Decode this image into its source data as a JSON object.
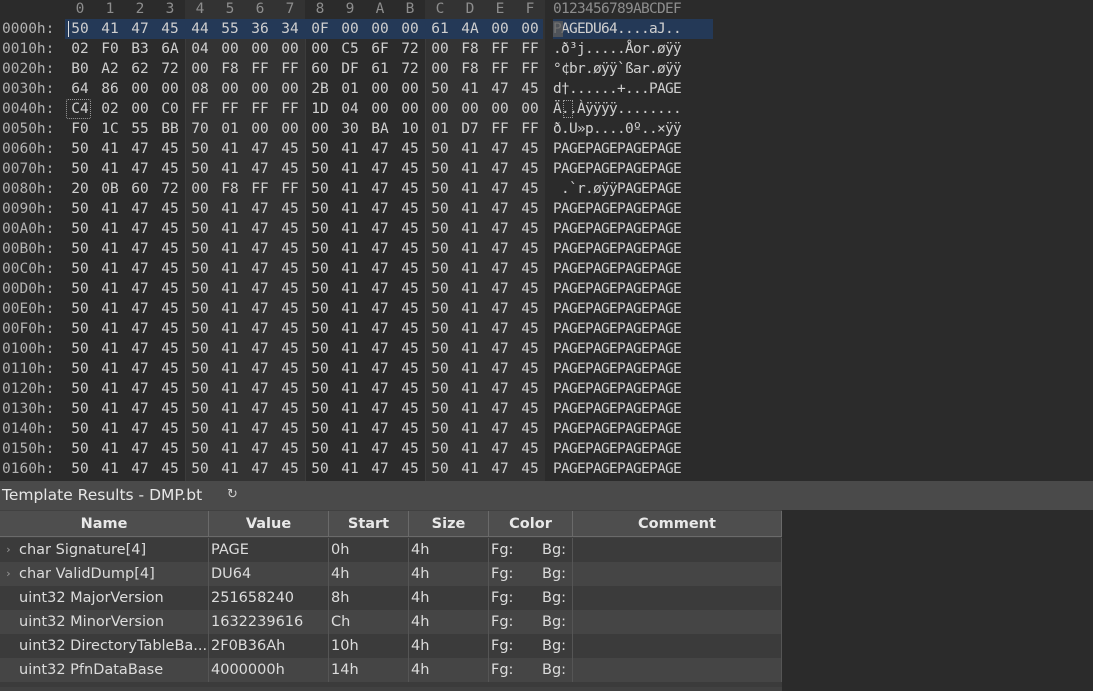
{
  "hex_view": {
    "columns": [
      "0",
      "1",
      "2",
      "3",
      "4",
      "5",
      "6",
      "7",
      "8",
      "9",
      "A",
      "B",
      "C",
      "D",
      "E",
      "F"
    ],
    "ascii_header": "0123456789ABCDEF",
    "rows": [
      {
        "addr": "0000h:",
        "bytes": [
          "50",
          "41",
          "47",
          "45",
          "44",
          "55",
          "36",
          "34",
          "0F",
          "00",
          "00",
          "00",
          "61",
          "4A",
          "00",
          "00"
        ],
        "ascii": "PAGEDU64....aJ.."
      },
      {
        "addr": "0010h:",
        "bytes": [
          "02",
          "F0",
          "B3",
          "6A",
          "04",
          "00",
          "00",
          "00",
          "00",
          "C5",
          "6F",
          "72",
          "00",
          "F8",
          "FF",
          "FF"
        ],
        "ascii": ".ð³j.....Åor.øÿÿ"
      },
      {
        "addr": "0020h:",
        "bytes": [
          "B0",
          "A2",
          "62",
          "72",
          "00",
          "F8",
          "FF",
          "FF",
          "60",
          "DF",
          "61",
          "72",
          "00",
          "F8",
          "FF",
          "FF"
        ],
        "ascii": "°¢br.øÿÿ`ßar.øÿÿ"
      },
      {
        "addr": "0030h:",
        "bytes": [
          "64",
          "86",
          "00",
          "00",
          "08",
          "00",
          "00",
          "00",
          "2B",
          "01",
          "00",
          "00",
          "50",
          "41",
          "47",
          "45"
        ],
        "ascii": "d†......+...PAGE"
      },
      {
        "addr": "0040h:",
        "bytes": [
          "C4",
          "02",
          "00",
          "C0",
          "FF",
          "FF",
          "FF",
          "FF",
          "1D",
          "04",
          "00",
          "00",
          "00",
          "00",
          "00",
          "00"
        ],
        "ascii": "Ä..Àÿÿÿÿ........"
      },
      {
        "addr": "0050h:",
        "bytes": [
          "F0",
          "1C",
          "55",
          "BB",
          "70",
          "01",
          "00",
          "00",
          "00",
          "30",
          "BA",
          "10",
          "01",
          "D7",
          "FF",
          "FF"
        ],
        "ascii": "ð.U»p....0º..×ÿÿ"
      },
      {
        "addr": "0060h:",
        "bytes": [
          "50",
          "41",
          "47",
          "45",
          "50",
          "41",
          "47",
          "45",
          "50",
          "41",
          "47",
          "45",
          "50",
          "41",
          "47",
          "45"
        ],
        "ascii": "PAGEPAGEPAGEPAGE"
      },
      {
        "addr": "0070h:",
        "bytes": [
          "50",
          "41",
          "47",
          "45",
          "50",
          "41",
          "47",
          "45",
          "50",
          "41",
          "47",
          "45",
          "50",
          "41",
          "47",
          "45"
        ],
        "ascii": "PAGEPAGEPAGEPAGE"
      },
      {
        "addr": "0080h:",
        "bytes": [
          "20",
          "0B",
          "60",
          "72",
          "00",
          "F8",
          "FF",
          "FF",
          "50",
          "41",
          "47",
          "45",
          "50",
          "41",
          "47",
          "45"
        ],
        "ascii": " .`r.øÿÿPAGEPAGE"
      },
      {
        "addr": "0090h:",
        "bytes": [
          "50",
          "41",
          "47",
          "45",
          "50",
          "41",
          "47",
          "45",
          "50",
          "41",
          "47",
          "45",
          "50",
          "41",
          "47",
          "45"
        ],
        "ascii": "PAGEPAGEPAGEPAGE"
      },
      {
        "addr": "00A0h:",
        "bytes": [
          "50",
          "41",
          "47",
          "45",
          "50",
          "41",
          "47",
          "45",
          "50",
          "41",
          "47",
          "45",
          "50",
          "41",
          "47",
          "45"
        ],
        "ascii": "PAGEPAGEPAGEPAGE"
      },
      {
        "addr": "00B0h:",
        "bytes": [
          "50",
          "41",
          "47",
          "45",
          "50",
          "41",
          "47",
          "45",
          "50",
          "41",
          "47",
          "45",
          "50",
          "41",
          "47",
          "45"
        ],
        "ascii": "PAGEPAGEPAGEPAGE"
      },
      {
        "addr": "00C0h:",
        "bytes": [
          "50",
          "41",
          "47",
          "45",
          "50",
          "41",
          "47",
          "45",
          "50",
          "41",
          "47",
          "45",
          "50",
          "41",
          "47",
          "45"
        ],
        "ascii": "PAGEPAGEPAGEPAGE"
      },
      {
        "addr": "00D0h:",
        "bytes": [
          "50",
          "41",
          "47",
          "45",
          "50",
          "41",
          "47",
          "45",
          "50",
          "41",
          "47",
          "45",
          "50",
          "41",
          "47",
          "45"
        ],
        "ascii": "PAGEPAGEPAGEPAGE"
      },
      {
        "addr": "00E0h:",
        "bytes": [
          "50",
          "41",
          "47",
          "45",
          "50",
          "41",
          "47",
          "45",
          "50",
          "41",
          "47",
          "45",
          "50",
          "41",
          "47",
          "45"
        ],
        "ascii": "PAGEPAGEPAGEPAGE"
      },
      {
        "addr": "00F0h:",
        "bytes": [
          "50",
          "41",
          "47",
          "45",
          "50",
          "41",
          "47",
          "45",
          "50",
          "41",
          "47",
          "45",
          "50",
          "41",
          "47",
          "45"
        ],
        "ascii": "PAGEPAGEPAGEPAGE"
      },
      {
        "addr": "0100h:",
        "bytes": [
          "50",
          "41",
          "47",
          "45",
          "50",
          "41",
          "47",
          "45",
          "50",
          "41",
          "47",
          "45",
          "50",
          "41",
          "47",
          "45"
        ],
        "ascii": "PAGEPAGEPAGEPAGE"
      },
      {
        "addr": "0110h:",
        "bytes": [
          "50",
          "41",
          "47",
          "45",
          "50",
          "41",
          "47",
          "45",
          "50",
          "41",
          "47",
          "45",
          "50",
          "41",
          "47",
          "45"
        ],
        "ascii": "PAGEPAGEPAGEPAGE"
      },
      {
        "addr": "0120h:",
        "bytes": [
          "50",
          "41",
          "47",
          "45",
          "50",
          "41",
          "47",
          "45",
          "50",
          "41",
          "47",
          "45",
          "50",
          "41",
          "47",
          "45"
        ],
        "ascii": "PAGEPAGEPAGEPAGE"
      },
      {
        "addr": "0130h:",
        "bytes": [
          "50",
          "41",
          "47",
          "45",
          "50",
          "41",
          "47",
          "45",
          "50",
          "41",
          "47",
          "45",
          "50",
          "41",
          "47",
          "45"
        ],
        "ascii": "PAGEPAGEPAGEPAGE"
      },
      {
        "addr": "0140h:",
        "bytes": [
          "50",
          "41",
          "47",
          "45",
          "50",
          "41",
          "47",
          "45",
          "50",
          "41",
          "47",
          "45",
          "50",
          "41",
          "47",
          "45"
        ],
        "ascii": "PAGEPAGEPAGEPAGE"
      },
      {
        "addr": "0150h:",
        "bytes": [
          "50",
          "41",
          "47",
          "45",
          "50",
          "41",
          "47",
          "45",
          "50",
          "41",
          "47",
          "45",
          "50",
          "41",
          "47",
          "45"
        ],
        "ascii": "PAGEPAGEPAGEPAGE"
      },
      {
        "addr": "0160h:",
        "bytes": [
          "50",
          "41",
          "47",
          "45",
          "50",
          "41",
          "47",
          "45",
          "50",
          "41",
          "47",
          "45",
          "50",
          "41",
          "47",
          "45"
        ],
        "ascii": "PAGEPAGEPAGEPAGE"
      }
    ]
  },
  "template_results": {
    "title": "Template Results - DMP.bt",
    "refresh_icon": "refresh-icon",
    "columns": [
      "Name",
      "Value",
      "Start",
      "Size",
      "Color",
      "Comment"
    ],
    "rows": [
      {
        "name": "char Signature[4]",
        "value": "PAGE",
        "start": "0h",
        "size": "4h",
        "fg": "Fg:",
        "bg": "Bg:",
        "comment": "",
        "expandable": true
      },
      {
        "name": "char ValidDump[4]",
        "value": "DU64",
        "start": "4h",
        "size": "4h",
        "fg": "Fg:",
        "bg": "Bg:",
        "comment": "",
        "expandable": true
      },
      {
        "name": "uint32 MajorVersion",
        "value": "251658240",
        "start": "8h",
        "size": "4h",
        "fg": "Fg:",
        "bg": "Bg:",
        "comment": "",
        "expandable": false
      },
      {
        "name": "uint32 MinorVersion",
        "value": "1632239616",
        "start": "Ch",
        "size": "4h",
        "fg": "Fg:",
        "bg": "Bg:",
        "comment": "",
        "expandable": false
      },
      {
        "name": "uint32 DirectoryTableBa...",
        "value": "2F0B36Ah",
        "start": "10h",
        "size": "4h",
        "fg": "Fg:",
        "bg": "Bg:",
        "comment": "",
        "expandable": false
      },
      {
        "name": "uint32 PfnDataBase",
        "value": "4000000h",
        "start": "14h",
        "size": "4h",
        "fg": "Fg:",
        "bg": "Bg:",
        "comment": "",
        "expandable": false
      }
    ]
  },
  "colors": {
    "background": "#2b2b2b",
    "selection": "#243957",
    "panel": "#414141",
    "header": "#4e4e4e"
  }
}
